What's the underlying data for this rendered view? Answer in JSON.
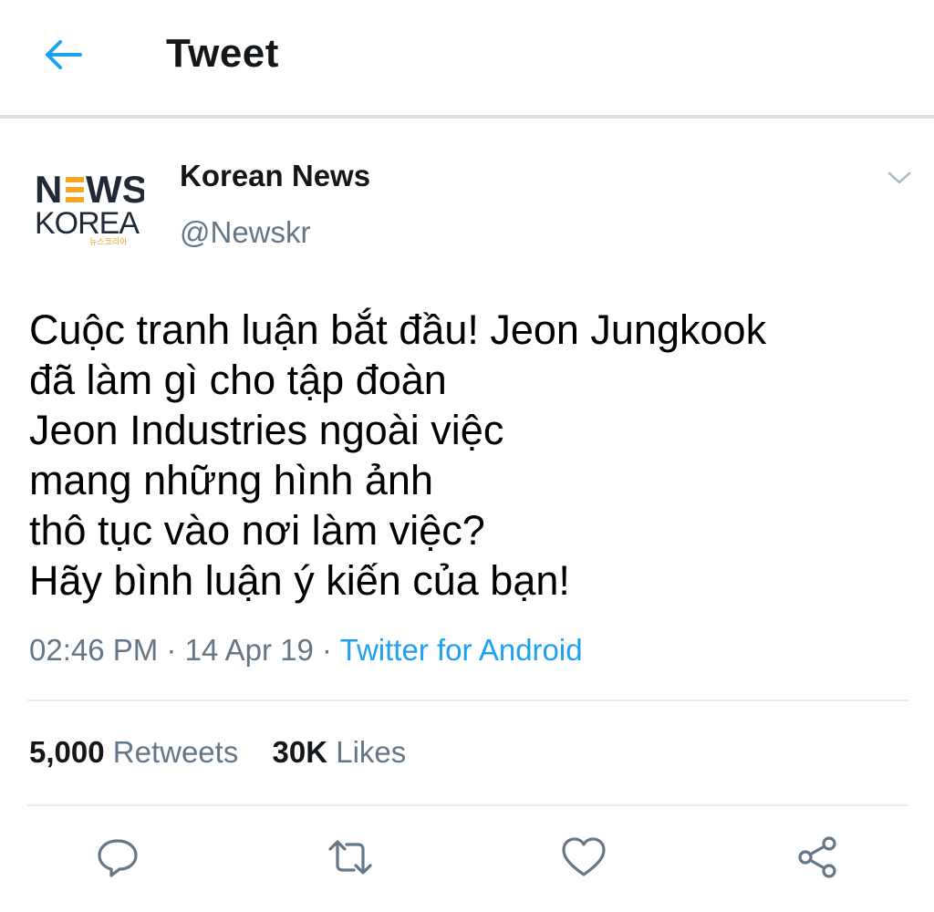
{
  "header": {
    "title": "Tweet",
    "back_icon": "arrow-left-icon"
  },
  "author": {
    "name": "Korean News",
    "handle": "@Newskr",
    "avatar_logo": {
      "line1": "NEWS",
      "line2": "KOREA",
      "tagline": "뉴스코리아"
    }
  },
  "tweet": {
    "lines": [
      "Cuộc tranh luận bắt đầu! Jeon Jungkook",
      "đã làm gì cho tập đoàn",
      "Jeon Industries ngoài việc",
      "mang những hình ảnh",
      "thô tục vào nơi làm việc?",
      "Hãy bình luận ý kiến của bạn!"
    ]
  },
  "meta": {
    "time": "02:46 PM",
    "separator": "·",
    "date": "14 Apr 19",
    "source": "Twitter for Android"
  },
  "stats": {
    "retweets_count": "5,000",
    "retweets_label": "Retweets",
    "likes_count": "30K",
    "likes_label": "Likes"
  },
  "actions": [
    {
      "name": "reply",
      "icon": "reply-icon"
    },
    {
      "name": "retweet",
      "icon": "retweet-icon"
    },
    {
      "name": "like",
      "icon": "heart-icon"
    },
    {
      "name": "share",
      "icon": "share-icon"
    }
  ],
  "colors": {
    "accent": "#1da1f2",
    "text_primary": "#14171a",
    "text_secondary": "#657786",
    "divider": "#e6ecf0",
    "logo_orange": "#f5a623",
    "logo_dark": "#1f2a36"
  }
}
